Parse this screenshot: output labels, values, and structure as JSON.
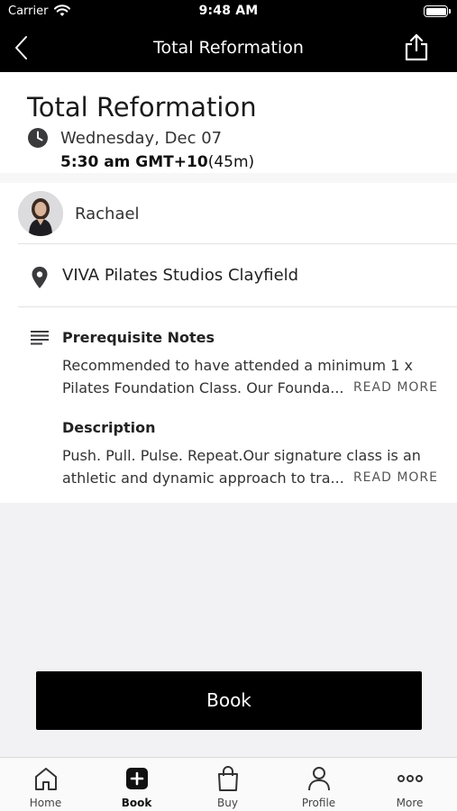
{
  "status_bar": {
    "carrier": "Carrier",
    "time": "9:48 AM"
  },
  "nav": {
    "title": "Total Reformation",
    "back_icon": "chevron-left-icon",
    "share_icon": "share-icon"
  },
  "event": {
    "title": "Total Reformation",
    "date": "Wednesday, Dec 07",
    "time": "5:30 am GMT+10",
    "duration": "(45m)"
  },
  "instructor": {
    "name": "Rachael"
  },
  "location": {
    "name": "VIVA Pilates Studios Clayfield"
  },
  "prerequisite": {
    "title": "Prerequisite Notes",
    "line1": "Recommended to have attended a minimum 1 x",
    "line2": "Pilates Foundation Class. Our Founda...",
    "read_more": "READ MORE"
  },
  "description": {
    "title": "Description",
    "line1": "Push. Pull. Pulse. Repeat.Our signature class is an",
    "line2": "athletic and dynamic approach to tra...",
    "read_more": "READ MORE"
  },
  "book_button": {
    "label": "Book"
  },
  "tabs": [
    {
      "label": "Home",
      "icon": "home-icon",
      "active": false
    },
    {
      "label": "Book",
      "icon": "plus-square-icon",
      "active": true
    },
    {
      "label": "Buy",
      "icon": "shopping-bag-icon",
      "active": false
    },
    {
      "label": "Profile",
      "icon": "person-icon",
      "active": false
    },
    {
      "label": "More",
      "icon": "more-dots-icon",
      "active": false
    }
  ],
  "colors": {
    "bar": "#000000",
    "background": "#f2f2f4",
    "accent": "#000000"
  }
}
